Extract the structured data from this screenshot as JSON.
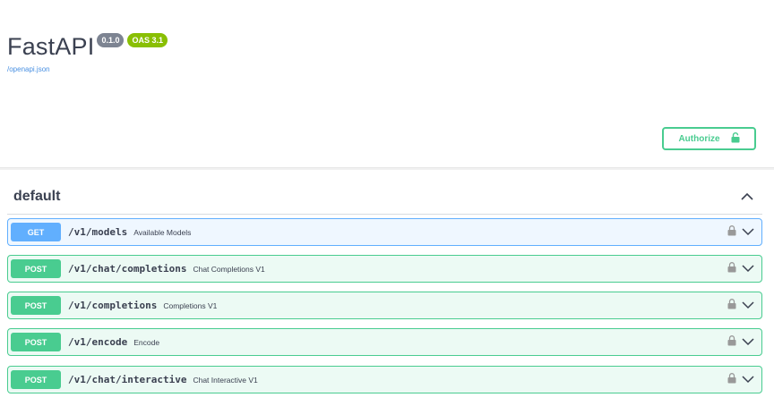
{
  "info": {
    "title": "FastAPI",
    "version_badge": "0.1.0",
    "oas_badge": "OAS 3.1",
    "spec_link": "/openapi.json"
  },
  "authorize": {
    "label": "Authorize",
    "icon": "unlock-icon"
  },
  "section": {
    "title": "default",
    "icon": "chevron-up-icon"
  },
  "operations": [
    {
      "method": "GET",
      "path": "/v1/models",
      "summary": "Available Models"
    },
    {
      "method": "POST",
      "path": "/v1/chat/completions",
      "summary": "Chat Completions V1"
    },
    {
      "method": "POST",
      "path": "/v1/completions",
      "summary": "Completions V1"
    },
    {
      "method": "POST",
      "path": "/v1/encode",
      "summary": "Encode"
    },
    {
      "method": "POST",
      "path": "/v1/chat/interactive",
      "summary": "Chat Interactive V1"
    }
  ],
  "colors": {
    "get": "#61affe",
    "post": "#49cc90",
    "version_badge": "#7d8492",
    "oas_badge": "#89bf04",
    "link": "#4990e2"
  }
}
